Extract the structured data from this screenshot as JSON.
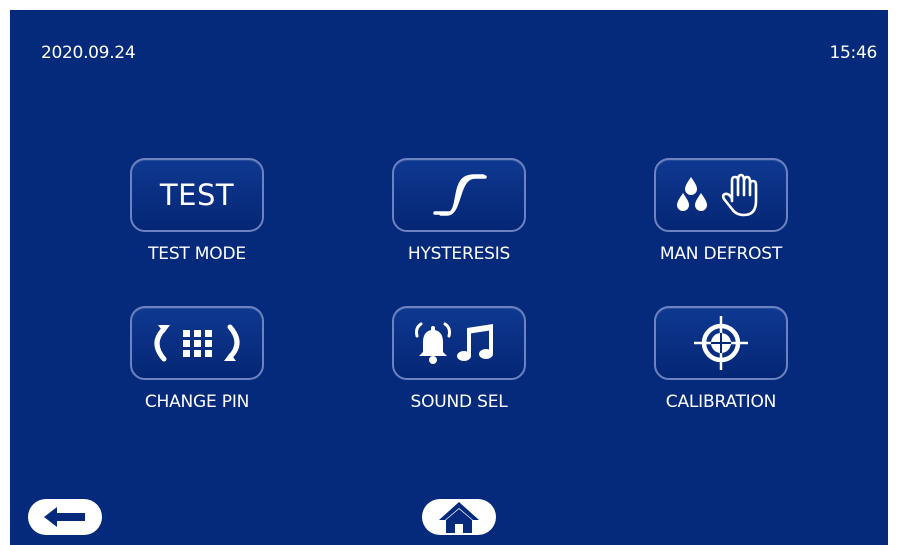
{
  "status": {
    "date": "2020.09.24",
    "time": "15:46"
  },
  "menu": [
    {
      "id": "test-mode",
      "button_text": "TEST",
      "label": "TEST MODE",
      "icon": "text-test"
    },
    {
      "id": "hysteresis",
      "label": "HYSTERESIS",
      "icon": "hysteresis-curve-icon"
    },
    {
      "id": "man-defrost",
      "label": "MAN DEFROST",
      "icon": "water-drops-hand-icon"
    },
    {
      "id": "change-pin",
      "label": "CHANGE PIN",
      "icon": "keypad-refresh-icon"
    },
    {
      "id": "sound-sel",
      "label": "SOUND SEL",
      "icon": "bell-music-note-icon"
    },
    {
      "id": "calibration",
      "label": "CALIBRATION",
      "icon": "crosshair-target-icon"
    }
  ],
  "nav": {
    "back_icon": "arrow-left-icon",
    "home_icon": "home-icon"
  },
  "colors": {
    "background": "#052a7c",
    "button_border": "#6d82c0",
    "text": "#ffffff",
    "nav_button": "#ffffff"
  }
}
